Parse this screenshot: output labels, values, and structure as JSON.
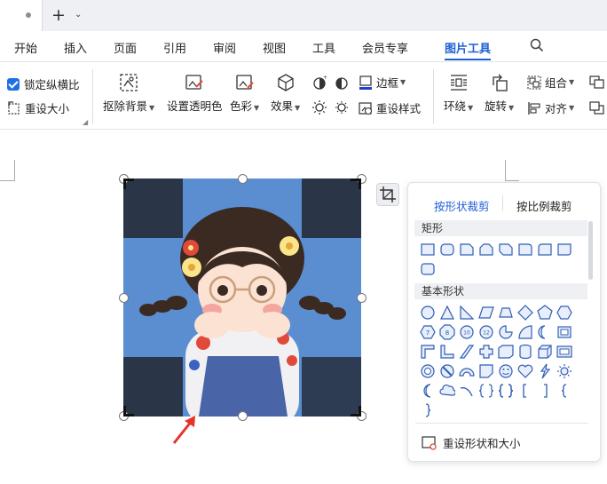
{
  "titlebar": {
    "new_tab_symbol": "+",
    "new_tab_caret": "⌄"
  },
  "menu": {
    "items": [
      "开始",
      "插入",
      "页面",
      "引用",
      "审阅",
      "视图",
      "工具",
      "会员专享",
      "图片工具"
    ],
    "active": "图片工具"
  },
  "ribbon": {
    "lock_ratio": "锁定纵横比",
    "lock_ratio_checked": true,
    "reset_size": "重设大小",
    "remove_bg": "抠除背景",
    "set_transparent": "设置透明色",
    "color": "色彩",
    "effects": "效果",
    "border": "边框",
    "reset_style": "重设样式",
    "wrap": "环绕",
    "rotate": "旋转",
    "group": "组合",
    "align": "对齐"
  },
  "crop_panel": {
    "tab_shape": "按形状裁剪",
    "tab_ratio": "按比例裁剪",
    "section_rect": "矩形",
    "section_basic": "基本形状",
    "reset_shape_size": "重设形状和大小",
    "accent_color": "#1f5fd6",
    "shape_icon_color": "#2f5fb3"
  },
  "picture": {
    "subject": "cartoon-girl-with-glasses",
    "background_color": "#5b8ed1",
    "cropped_corner_color": "#2a3548"
  }
}
